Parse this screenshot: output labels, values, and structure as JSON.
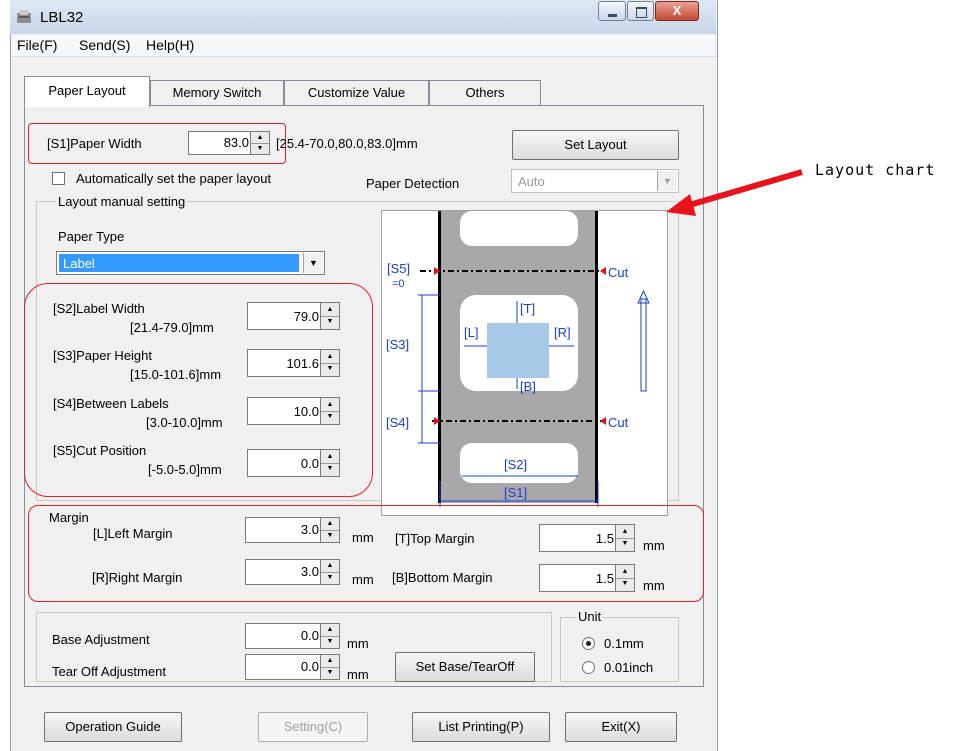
{
  "window": {
    "title": "LBL32",
    "close_glyph": "X"
  },
  "menu": [
    "File(F)",
    "Send(S)",
    "Help(H)"
  ],
  "tabs": [
    "Paper Layout",
    "Memory Switch",
    "Customize Value",
    "Others"
  ],
  "paper": {
    "s1_label": "[S1]Paper Width",
    "s1_value": "83.0",
    "s1_range": "[25.4-70.0,80.0,83.0]mm",
    "set_layout": "Set Layout",
    "auto_label": "Automatically set the paper layout",
    "detection_label": "Paper Detection",
    "detection_value": "Auto"
  },
  "manual": {
    "group_title": "Layout manual setting",
    "paper_type_label": "Paper Type",
    "paper_type_value": "Label",
    "s2_label": "[S2]Label Width",
    "s2_range": "[21.4-79.0]mm",
    "s2_value": "79.0",
    "s3_label": "[S3]Paper Height",
    "s3_range": "[15.0-101.6]mm",
    "s3_value": "101.6",
    "s4_label": "[S4]Between Labels",
    "s4_range": "[3.0-10.0]mm",
    "s4_value": "10.0",
    "s5_label": "[S5]Cut Position",
    "s5_range": "[-5.0-5.0]mm",
    "s5_value": "0.0"
  },
  "margin": {
    "title": "Margin",
    "left_label": "[L]Left Margin",
    "left_value": "3.0",
    "right_label": "[R]Right Margin",
    "right_value": "3.0",
    "top_label": "[T]Top Margin",
    "top_value": "1.5",
    "bottom_label": "[B]Bottom Margin",
    "bottom_value": "1.5",
    "unit": "mm"
  },
  "adjust": {
    "base_label": "Base Adjustment",
    "base_value": "0.0",
    "tear_label": "Tear Off Adjustment",
    "tear_value": "0.0",
    "unit": "mm",
    "set_button": "Set Base/TearOff"
  },
  "unit_group": {
    "title": "Unit",
    "opt1": "0.1mm",
    "opt2": "0.01inch"
  },
  "footer": {
    "guide": "Operation Guide",
    "setting": "Setting(C)",
    "list": "List Printing(P)",
    "exit": "Exit(X)"
  },
  "chart": {
    "s5": "[S5]",
    "s5_zero": "=0",
    "cut": "Cut",
    "t": "[T]",
    "l": "[L]",
    "r": "[R]",
    "b": "[B]",
    "s3": "[S3]",
    "s4": "[S4]",
    "s2": "[S2]",
    "s1": "[S1]"
  },
  "annotation": {
    "text": "Layout chart",
    "color": "#e8141c"
  }
}
